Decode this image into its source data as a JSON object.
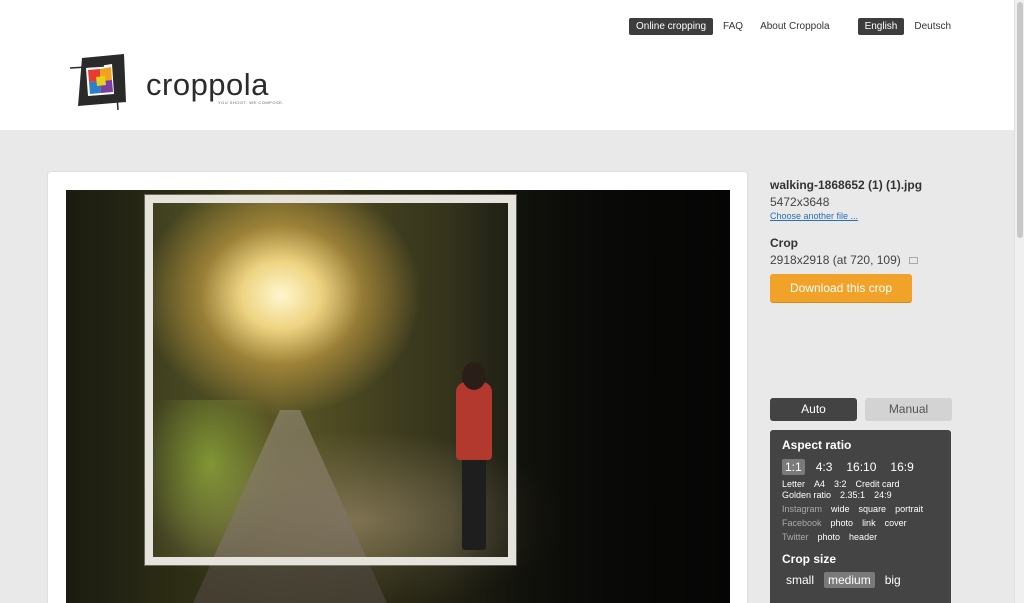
{
  "topnav": {
    "items": [
      "Online cropping",
      "FAQ",
      "About Croppola"
    ],
    "languages": [
      "English",
      "Deutsch"
    ]
  },
  "logo": {
    "word": "croppola",
    "tagline": "YOU SHOOT. WE COMPOSE."
  },
  "file": {
    "name": "walking-1868652 (1) (1).jpg",
    "dimensions": "5472x3648",
    "choose_link": "Choose another file ..."
  },
  "crop": {
    "title": "Crop",
    "info": "2918x2918 (at 720, 109)",
    "download_label": "Download this crop"
  },
  "modes": {
    "auto": "Auto",
    "manual": "Manual"
  },
  "aspect_ratio": {
    "title": "Aspect ratio",
    "main": [
      "1:1",
      "4:3",
      "16:10",
      "16:9"
    ],
    "row2": [
      "Letter",
      "A4",
      "3:2",
      "Credit card"
    ],
    "row3": [
      "Golden ratio",
      "2.35:1",
      "24:9"
    ],
    "instagram": {
      "label": "Instagram",
      "options": [
        "wide",
        "square",
        "portrait"
      ]
    },
    "facebook": {
      "label": "Facebook",
      "options": [
        "photo",
        "link",
        "cover"
      ]
    },
    "twitter": {
      "label": "Twitter",
      "options": [
        "photo",
        "header"
      ]
    }
  },
  "crop_size": {
    "title": "Crop size",
    "options": [
      "small",
      "medium",
      "big"
    ]
  },
  "colors": {
    "accent_orange": "#f0a328",
    "dark_panel": "#444444",
    "active_nav": "#3d3d3d"
  }
}
